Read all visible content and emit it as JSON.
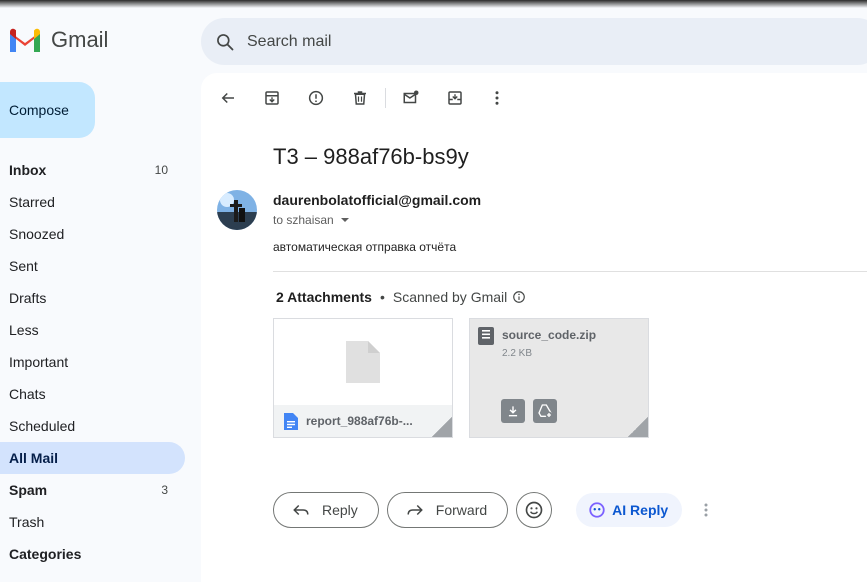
{
  "app": {
    "name": "Gmail"
  },
  "search": {
    "placeholder": "Search mail"
  },
  "compose": {
    "label": "Compose"
  },
  "nav": [
    {
      "label": "Inbox",
      "count": "10",
      "bold": true,
      "active": false,
      "name": "nav-item-inbox"
    },
    {
      "label": "Starred",
      "count": "",
      "bold": false,
      "active": false,
      "name": "nav-item-starred"
    },
    {
      "label": "Snoozed",
      "count": "",
      "bold": false,
      "active": false,
      "name": "nav-item-snoozed"
    },
    {
      "label": "Sent",
      "count": "",
      "bold": false,
      "active": false,
      "name": "nav-item-sent"
    },
    {
      "label": "Drafts",
      "count": "",
      "bold": false,
      "active": false,
      "name": "nav-item-drafts"
    },
    {
      "label": "Less",
      "count": "",
      "bold": false,
      "active": false,
      "name": "nav-item-less"
    },
    {
      "label": "Important",
      "count": "",
      "bold": false,
      "active": false,
      "name": "nav-item-important"
    },
    {
      "label": "Chats",
      "count": "",
      "bold": false,
      "active": false,
      "name": "nav-item-chats"
    },
    {
      "label": "Scheduled",
      "count": "",
      "bold": false,
      "active": false,
      "name": "nav-item-scheduled"
    },
    {
      "label": "All Mail",
      "count": "",
      "bold": true,
      "active": true,
      "name": "nav-item-all-mail"
    },
    {
      "label": "Spam",
      "count": "3",
      "bold": true,
      "active": false,
      "name": "nav-item-spam"
    },
    {
      "label": "Trash",
      "count": "",
      "bold": false,
      "active": false,
      "name": "nav-item-trash"
    },
    {
      "label": "Categories",
      "count": "",
      "bold": true,
      "active": false,
      "name": "nav-item-categories"
    }
  ],
  "toolbar": {
    "icons": [
      "back-arrow-icon",
      "archive-icon",
      "report-spam-icon",
      "delete-icon",
      "mark-unread-icon",
      "move-to-icon",
      "more-vert-icon"
    ]
  },
  "email": {
    "subject": "T3 – 988af76b-bs9y",
    "sender": "daurenbolatofficial@gmail.com",
    "recipient": "to szhaisan",
    "body": "автоматическая отправка отчёта"
  },
  "attachments": {
    "count_label": "2 Attachments",
    "separator": "•",
    "scan_label": "Scanned by Gmail",
    "items": [
      {
        "name": "report_988af76b-...",
        "type": "doc"
      },
      {
        "name": "source_code.zip",
        "size": "2.2 KB",
        "type": "zip"
      }
    ]
  },
  "actions": {
    "reply": "Reply",
    "forward": "Forward",
    "ai_reply": "AI Reply"
  },
  "colors": {
    "background": "#f8fafd",
    "compose_bg": "#c2e7ff",
    "active_nav": "#d3e3fd",
    "search_bg": "#e9eef6",
    "ai_text": "#0b57d0"
  }
}
